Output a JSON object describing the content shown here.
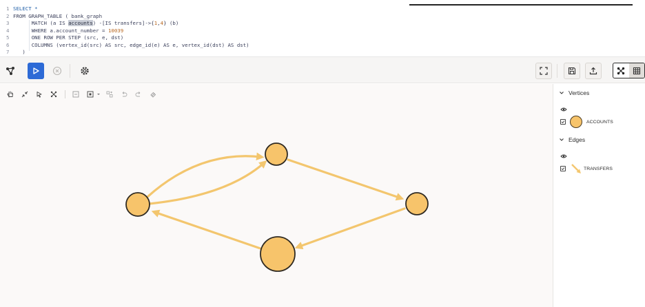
{
  "editor": {
    "lines": [
      {
        "num": "1",
        "segments": [
          {
            "t": "SELECT *",
            "c": "kw"
          }
        ]
      },
      {
        "num": "2",
        "segments": [
          {
            "t": "FROM GRAPH_TABLE ( bank_graph",
            "c": ""
          }
        ]
      },
      {
        "num": "3",
        "segments": [
          {
            "t": "      MATCH (a IS ",
            "c": ""
          },
          {
            "t": "accounts",
            "c": "sel"
          },
          {
            "t": ") -[IS transfers]->{",
            "c": ""
          },
          {
            "t": "1",
            "c": "num"
          },
          {
            "t": ",",
            "c": ""
          },
          {
            "t": "4",
            "c": "num"
          },
          {
            "t": "} (b)",
            "c": ""
          }
        ]
      },
      {
        "num": "4",
        "segments": [
          {
            "t": "      WHERE a.account_number = ",
            "c": ""
          },
          {
            "t": "10039",
            "c": "num"
          }
        ]
      },
      {
        "num": "5",
        "segments": [
          {
            "t": "      ONE ROW PER STEP (src, e, dst)",
            "c": ""
          }
        ]
      },
      {
        "num": "6",
        "segments": [
          {
            "t": "      COLUMNS (vertex_id(src) AS src, edge_id(e) AS e, vertex_id(dst) AS dst)",
            "c": ""
          }
        ]
      },
      {
        "num": "7",
        "segments": [
          {
            "t": "   )",
            "c": ""
          }
        ]
      }
    ]
  },
  "toolbar": {
    "icons": [
      "graph-schema-icon",
      "run-icon",
      "cancel-icon",
      "settings-icon",
      "fullscreen-icon",
      "save-icon",
      "export-icon",
      "graph-view-icon",
      "table-view-icon"
    ],
    "accent": "#2d6ad6"
  },
  "canvas_tools": [
    "pan-icon",
    "fit-icon",
    "select-icon",
    "layout-icon",
    "collapse-icon",
    "group-icon",
    "expand-icon",
    "undo-icon",
    "redo-icon",
    "reset-icon"
  ],
  "graph": {
    "node_color": "#f7c46b",
    "edge_color": "#f3c66e",
    "nodes": [
      {
        "id": "n1",
        "label": ""
      },
      {
        "id": "n2",
        "label": ""
      },
      {
        "id": "n3",
        "label": ""
      },
      {
        "id": "n4",
        "label": ""
      }
    ],
    "edges": [
      {
        "from": "n1",
        "to": "n2"
      },
      {
        "from": "n1",
        "to": "n2"
      },
      {
        "from": "n2",
        "to": "n3"
      },
      {
        "from": "n3",
        "to": "n4"
      },
      {
        "from": "n4",
        "to": "n1"
      }
    ]
  },
  "legend": {
    "vertices_title": "Vertices",
    "vertex_label": "ACCOUNTS",
    "edges_title": "Edges",
    "edge_label": "TRANSFERS"
  }
}
